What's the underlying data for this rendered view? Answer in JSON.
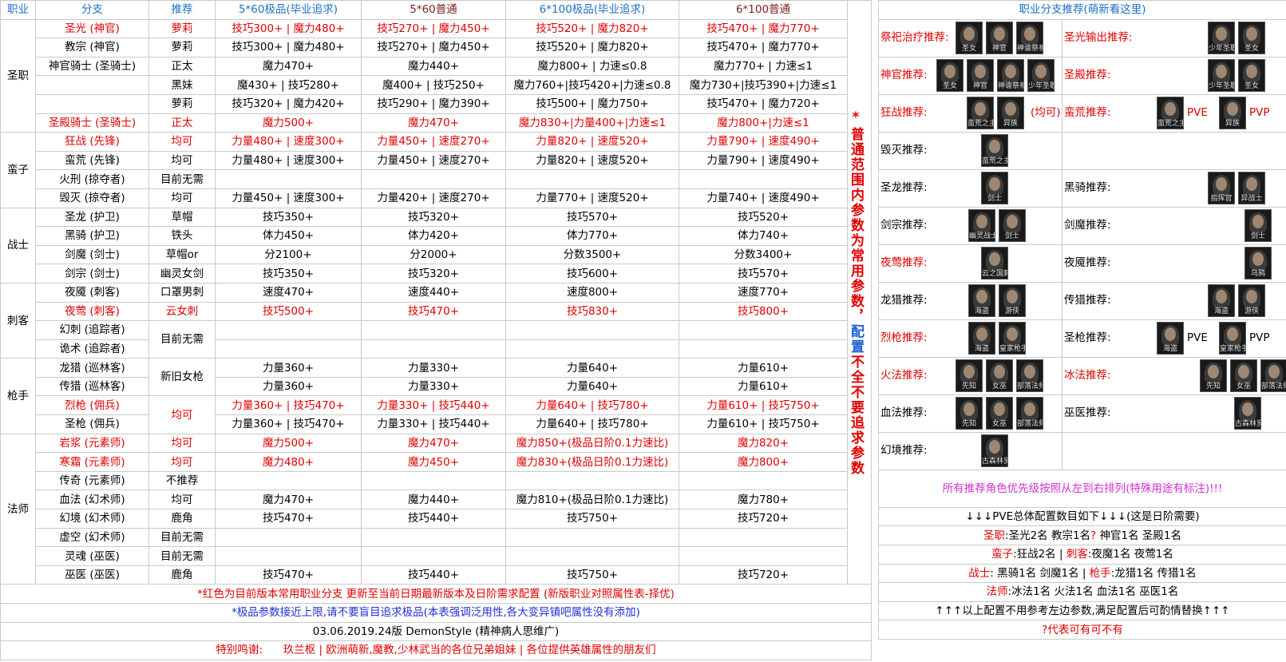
{
  "headers": {
    "job": "职业",
    "branch": "分支",
    "rec": "推荐",
    "c1": "5*60极品(毕业追求)",
    "c2": "5*60普通",
    "c3": "6*100极品(毕业追求)",
    "c4": "6*100普通"
  },
  "groups": {
    "priest": "圣职",
    "barbarian": "蛮子",
    "warrior": "战士",
    "assassin": "刺客",
    "gunner": "枪手",
    "mage": "法师"
  },
  "rows": [
    {
      "branch": "圣光 (神官)",
      "rec": "萝莉",
      "c1": "技巧300+ | 魔力480+",
      "c2": "技巧270+ | 魔力450+",
      "c3": "技巧520+ | 魔力820+",
      "c4": "技巧470+ | 魔力770+"
    },
    {
      "branch": "教宗 (神官)",
      "rec": "萝莉",
      "c1": "技巧300+ | 魔力480+",
      "c2": "技巧270+ | 魔力450+",
      "c3": "技巧520+ | 魔力820+",
      "c4": "技巧470+ | 魔力770+"
    },
    {
      "branch": "神官骑士 (圣骑士)",
      "rec": "正太",
      "c1": "魔力470+",
      "c2": "魔力440+",
      "c3": "魔力800+ | 力速≤0.8",
      "c4": "魔力770+ | 力速≤1"
    },
    {
      "branch": "",
      "rec": "黑妹",
      "c1": "魔430+ | 技巧280+",
      "c2": "魔400+ | 技巧250+",
      "c3": "魔力760+|技巧420+|力速≤0.8",
      "c4": "魔力730+|技巧390+|力速≤1"
    },
    {
      "branch": "",
      "rec": "萝莉",
      "c1": "技巧320+ | 魔力420+",
      "c2": "技巧290+ | 魔力390+",
      "c3": "技巧500+ | 魔力750+",
      "c4": "技巧470+ | 魔力720+"
    },
    {
      "branch": "圣殿骑士 (圣骑士)",
      "rec": "正太",
      "c1": "魔力500+",
      "c2": "魔力470+",
      "c3": "魔力830+|力量400+|力速≤1",
      "c4": "魔力800+|力速≤1"
    },
    {
      "branch": "狂战 (先锋)",
      "rec": "均可",
      "c1": "力量480+ | 速度300+",
      "c2": "力量450+ | 速度270+",
      "c3": "力量820+ | 速度520+",
      "c4": "力量790+ | 速度490+"
    },
    {
      "branch": "蛮荒 (先锋)",
      "rec": "均可",
      "c1": "力量480+ | 速度300+",
      "c2": "力量450+ | 速度270+",
      "c3": "力量820+ | 速度520+",
      "c4": "力量790+ | 速度490+"
    },
    {
      "branch": "火刑 (掠夺者)",
      "rec": "目前无需",
      "c1": "",
      "c2": "",
      "c3": "",
      "c4": ""
    },
    {
      "branch": "毁灭 (掠夺者)",
      "rec": "均可",
      "c1": "力量450+ | 速度300+",
      "c2": "力量420+ | 速度270+",
      "c3": "力量770+ | 速度520+",
      "c4": "力量740+ | 速度490+"
    },
    {
      "branch": "圣龙 (护卫)",
      "rec": "草帽",
      "c1": "技巧350+",
      "c2": "技巧320+",
      "c3": "技巧570+",
      "c4": "技巧520+"
    },
    {
      "branch": "黑骑 (护卫)",
      "rec": "铁头",
      "c1": "体力450+",
      "c2": "体力420+",
      "c3": "体力770+",
      "c4": "体力740+"
    },
    {
      "branch": "剑魔 (剑士)",
      "rec": "草帽or",
      "c1": "分2100+",
      "c2": "分2000+",
      "c3": "分数3500+",
      "c4": "分数3400+"
    },
    {
      "branch": "剑宗 (剑士)",
      "rec": "幽灵女剑",
      "c1": "技巧350+",
      "c2": "技巧320+",
      "c3": "技巧600+",
      "c4": "技巧570+"
    },
    {
      "branch": "夜魇 (刺客)",
      "rec": "口罩男刺",
      "c1": "速度470+",
      "c2": "速度440+",
      "c3": "速度800+",
      "c4": "速度770+"
    },
    {
      "branch": "夜莺 (刺客)",
      "rec": "云女刺",
      "c1": "技巧500+",
      "c2": "技巧470+",
      "c3": "技巧830+",
      "c4": "技巧800+"
    },
    {
      "branch": "幻刺 (追踪者)",
      "rec": "目前无需",
      "c1": "",
      "c2": "",
      "c3": "",
      "c4": ""
    },
    {
      "branch": "诡术 (追踪者)",
      "rec": "",
      "c1": "",
      "c2": "",
      "c3": "",
      "c4": ""
    },
    {
      "branch": "龙猎 (巡林客)",
      "rec": "新旧女枪",
      "c1": "力量360+",
      "c2": "力量330+",
      "c3": "力量640+",
      "c4": "力量610+"
    },
    {
      "branch": "传猎 (巡林客)",
      "rec": "",
      "c1": "力量360+",
      "c2": "力量330+",
      "c3": "力量640+",
      "c4": "力量610+"
    },
    {
      "branch": "烈枪 (佣兵)",
      "rec": "均可",
      "c1": "力量360+ | 技巧470+",
      "c2": "力量330+ | 技巧440+",
      "c3": "力量640+ | 技巧780+",
      "c4": "力量610+ | 技巧750+"
    },
    {
      "branch": "圣枪 (佣兵)",
      "rec": "",
      "c1": "力量360+ | 技巧470+",
      "c2": "力量330+ | 技巧440+",
      "c3": "力量640+ | 技巧780+",
      "c4": "力量610+ | 技巧750+"
    },
    {
      "branch": "岩浆 (元素师)",
      "rec": "均可",
      "c1": "魔力500+",
      "c2": "魔力470+",
      "c3": "魔力850+(极品日阶0.1力速比)",
      "c4": "魔力820+"
    },
    {
      "branch": "寒霜 (元素师)",
      "rec": "均可",
      "c1": "魔力480+",
      "c2": "魔力450+",
      "c3": "魔力830+(极品日阶0.1力速比)",
      "c4": "魔力800+"
    },
    {
      "branch": "传奇 (元素师)",
      "rec": "不推荐",
      "c1": "",
      "c2": "",
      "c3": "",
      "c4": ""
    },
    {
      "branch": "血法 (幻术师)",
      "rec": "均可",
      "c1": "魔力470+",
      "c2": "魔力440+",
      "c3": "魔力810+(极品日阶0.1力速比)",
      "c4": "魔力780+"
    },
    {
      "branch": "幻境 (幻术师)",
      "rec": "鹿角",
      "c1": "技巧470+",
      "c2": "技巧440+",
      "c3": "技巧750+",
      "c4": "技巧720+"
    },
    {
      "branch": "虚空 (幻术师)",
      "rec": "目前无需",
      "c1": "",
      "c2": "",
      "c3": "",
      "c4": ""
    },
    {
      "branch": "灵魂 (巫医)",
      "rec": "目前无需",
      "c1": "",
      "c2": "",
      "c3": "",
      "c4": ""
    },
    {
      "branch": "巫医 (巫医)",
      "rec": "鹿角",
      "c1": "技巧470+",
      "c2": "技巧440+",
      "c3": "技巧750+",
      "c4": "技巧720+"
    }
  ],
  "side_note_parts": [
    "*",
    "普通范围内参数为常用参数，",
    "配置",
    "不全不要追求参数"
  ],
  "footer": {
    "line1": "*红色为目前版本常用职业分支 更新至当前日期最新版本及日阶需求配置  (新版职业对照属性表-择优)",
    "line2": "*极品参数接近上限,请不要盲目追求极品(本表强调泛用性,各大变异镇吧属性没有添加)",
    "line3": "03.06.2019.24版  DemonStyle (精神病人思维广)",
    "line4_label": "特别鸣谢:",
    "line4_text": "玖兰枢 | 欧洲萌新,魔教,少林武当的各位兄弟姐妹 | 各位提供英雄属性的朋友们"
  },
  "right": {
    "title": "职业分支推荐(萌新看这里)",
    "rows": [
      {
        "left": {
          "label": "祭祀治疗推荐:",
          "red": true,
          "avatars": [
            "圣女",
            "神官",
            "神谕祭祀"
          ]
        },
        "right": {
          "label": "圣光输出推荐:",
          "red": true,
          "avatars": [
            "少年圣职",
            "圣女"
          ]
        }
      },
      {
        "left": {
          "label": "神官推荐:",
          "red": true,
          "avatars": [
            "圣女",
            "神官",
            "神谕祭祀",
            "少年圣职"
          ]
        },
        "right": {
          "label": "圣殿推荐:",
          "red": true,
          "avatars": [
            "少年圣职",
            "圣女"
          ]
        }
      },
      {
        "left": {
          "label": "狂战推荐:",
          "red": true,
          "avatars": [
            "蛮荒之主",
            "异族"
          ],
          "note": "(均可)"
        },
        "right": {
          "label": "蛮荒推荐:",
          "red": true,
          "avatars": [
            "蛮荒之主",
            "异族"
          ],
          "tags": [
            "PVE",
            "PVP"
          ]
        }
      },
      {
        "left": {
          "label": "毁灭推荐:",
          "red": false,
          "avatars": [
            "蛮荒之主"
          ]
        },
        "right": {
          "label": "",
          "red": false,
          "avatars": []
        }
      },
      {
        "left": {
          "label": "圣龙推荐:",
          "red": false,
          "avatars": [
            "剑士"
          ]
        },
        "right": {
          "label": "黑骑推荐:",
          "red": false,
          "avatars": [
            "指挥官",
            "异战士"
          ]
        }
      },
      {
        "left": {
          "label": "剑宗推荐:",
          "red": false,
          "avatars": [
            "幽灵战士",
            "剑士"
          ]
        },
        "right": {
          "label": "剑魔推荐:",
          "red": false,
          "avatars": [
            "剑士"
          ]
        }
      },
      {
        "left": {
          "label": "夜莺推荐:",
          "red": true,
          "avatars": [
            "云之国刺客"
          ]
        },
        "right": {
          "label": "夜魇推荐:",
          "red": false,
          "avatars": [
            "乌鸦"
          ]
        }
      },
      {
        "left": {
          "label": "龙猎推荐:",
          "red": false,
          "avatars": [
            "海盗",
            "游侠"
          ]
        },
        "right": {
          "label": "传猎推荐:",
          "red": false,
          "avatars": [
            "海盗",
            "游侠"
          ]
        }
      },
      {
        "left": {
          "label": "烈枪推荐:",
          "red": true,
          "avatars": [
            "海盗",
            "皇家枪手"
          ]
        },
        "right": {
          "label": "圣枪推荐:",
          "red": false,
          "avatars": [
            "海盗",
            "皇家枪手"
          ],
          "tags": [
            "PVE",
            "PVP"
          ]
        }
      },
      {
        "left": {
          "label": "火法推荐:",
          "red": true,
          "avatars": [
            "先知",
            "女巫",
            "部落法师"
          ]
        },
        "right": {
          "label": "冰法推荐:",
          "red": true,
          "avatars": [
            "先知",
            "女巫",
            "部落法师"
          ]
        }
      },
      {
        "left": {
          "label": "血法推荐:",
          "red": false,
          "avatars": [
            "先知",
            "女巫",
            "部落法师"
          ]
        },
        "right": {
          "label": "巫医推荐:",
          "red": false,
          "avatars": [
            "古森林贤者"
          ]
        }
      },
      {
        "left": {
          "label": "幻境推荐:",
          "red": false,
          "avatars": [
            "古森林贤者"
          ]
        },
        "right": {
          "label": "",
          "red": false,
          "avatars": []
        }
      }
    ],
    "priority_note": "所有推荐角色优先级按照从左到右排列(特殊用途有标注)!!!",
    "pve_title": "↓↓↓PVE总体配置数目如下↓↓↓(这是日阶需要)",
    "pve_line1_a": "圣职",
    "pve_line1_b": ":圣光2名 教宗1名",
    "pve_line1_q": "?",
    "pve_line1_c": " 神官1名 圣殿1名",
    "pve_line2_a": "蛮子",
    "pve_line2_b": ":狂战2名 | ",
    "pve_line2_c": "刺客",
    "pve_line2_d": ":夜魔1名 夜莺1名",
    "pve_line3_a": "战士",
    "pve_line3_b": ": 黑骑1名 剑魔1名 | ",
    "pve_line3_c": "枪手",
    "pve_line3_d": ":龙猎1名 传猎1名",
    "pve_line4_a": "法师",
    "pve_line4_b": ":冰法1名 火法1名 血法1名 巫医1名",
    "pve_line5": "↑↑↑以上配置不用参考左边参数,满足配置后可酌情替换↑↑↑",
    "pve_line6": "?代表可有可不有"
  }
}
